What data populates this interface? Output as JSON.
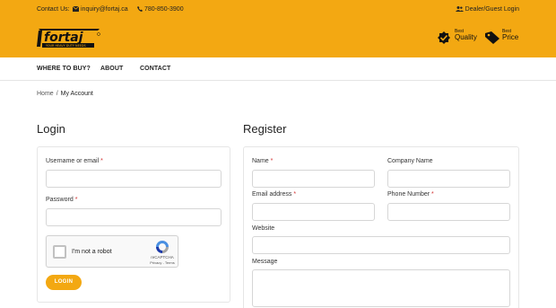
{
  "topbar": {
    "contact_label": "Contact Us:",
    "email": "inquiry@fortaj.ca",
    "phone": "780-850-3900",
    "dealer_login": "Dealer/Guest Login"
  },
  "brand": {
    "logo_text": "fortaj",
    "tagline": "YOUR HEAVY DUTY NEEDS",
    "accent_color": "#f3a812"
  },
  "badges": [
    {
      "small": "Best",
      "big": "Quality",
      "icon": "checkmark-icon"
    },
    {
      "small": "Best",
      "big": "Price",
      "icon": "price-tag-icon"
    }
  ],
  "nav": {
    "items": [
      "WHERE TO BUY?",
      "ABOUT",
      "CONTACT"
    ]
  },
  "breadcrumb": {
    "home": "Home",
    "separator": "/",
    "current": "My Account"
  },
  "login": {
    "title": "Login",
    "username_label": "Username or email",
    "password_label": "Password",
    "required_mark": "*",
    "captcha_label": "I'm not a robot",
    "captcha_brand": "reCAPTCHA",
    "captcha_terms": "Privacy - Terms",
    "button": "LOGIN"
  },
  "register": {
    "title": "Register",
    "name_label": "Name",
    "company_label": "Company Name",
    "email_label": "Email address",
    "phone_label": "Phone Number",
    "website_label": "Website",
    "message_label": "Message",
    "required_mark": "*"
  }
}
